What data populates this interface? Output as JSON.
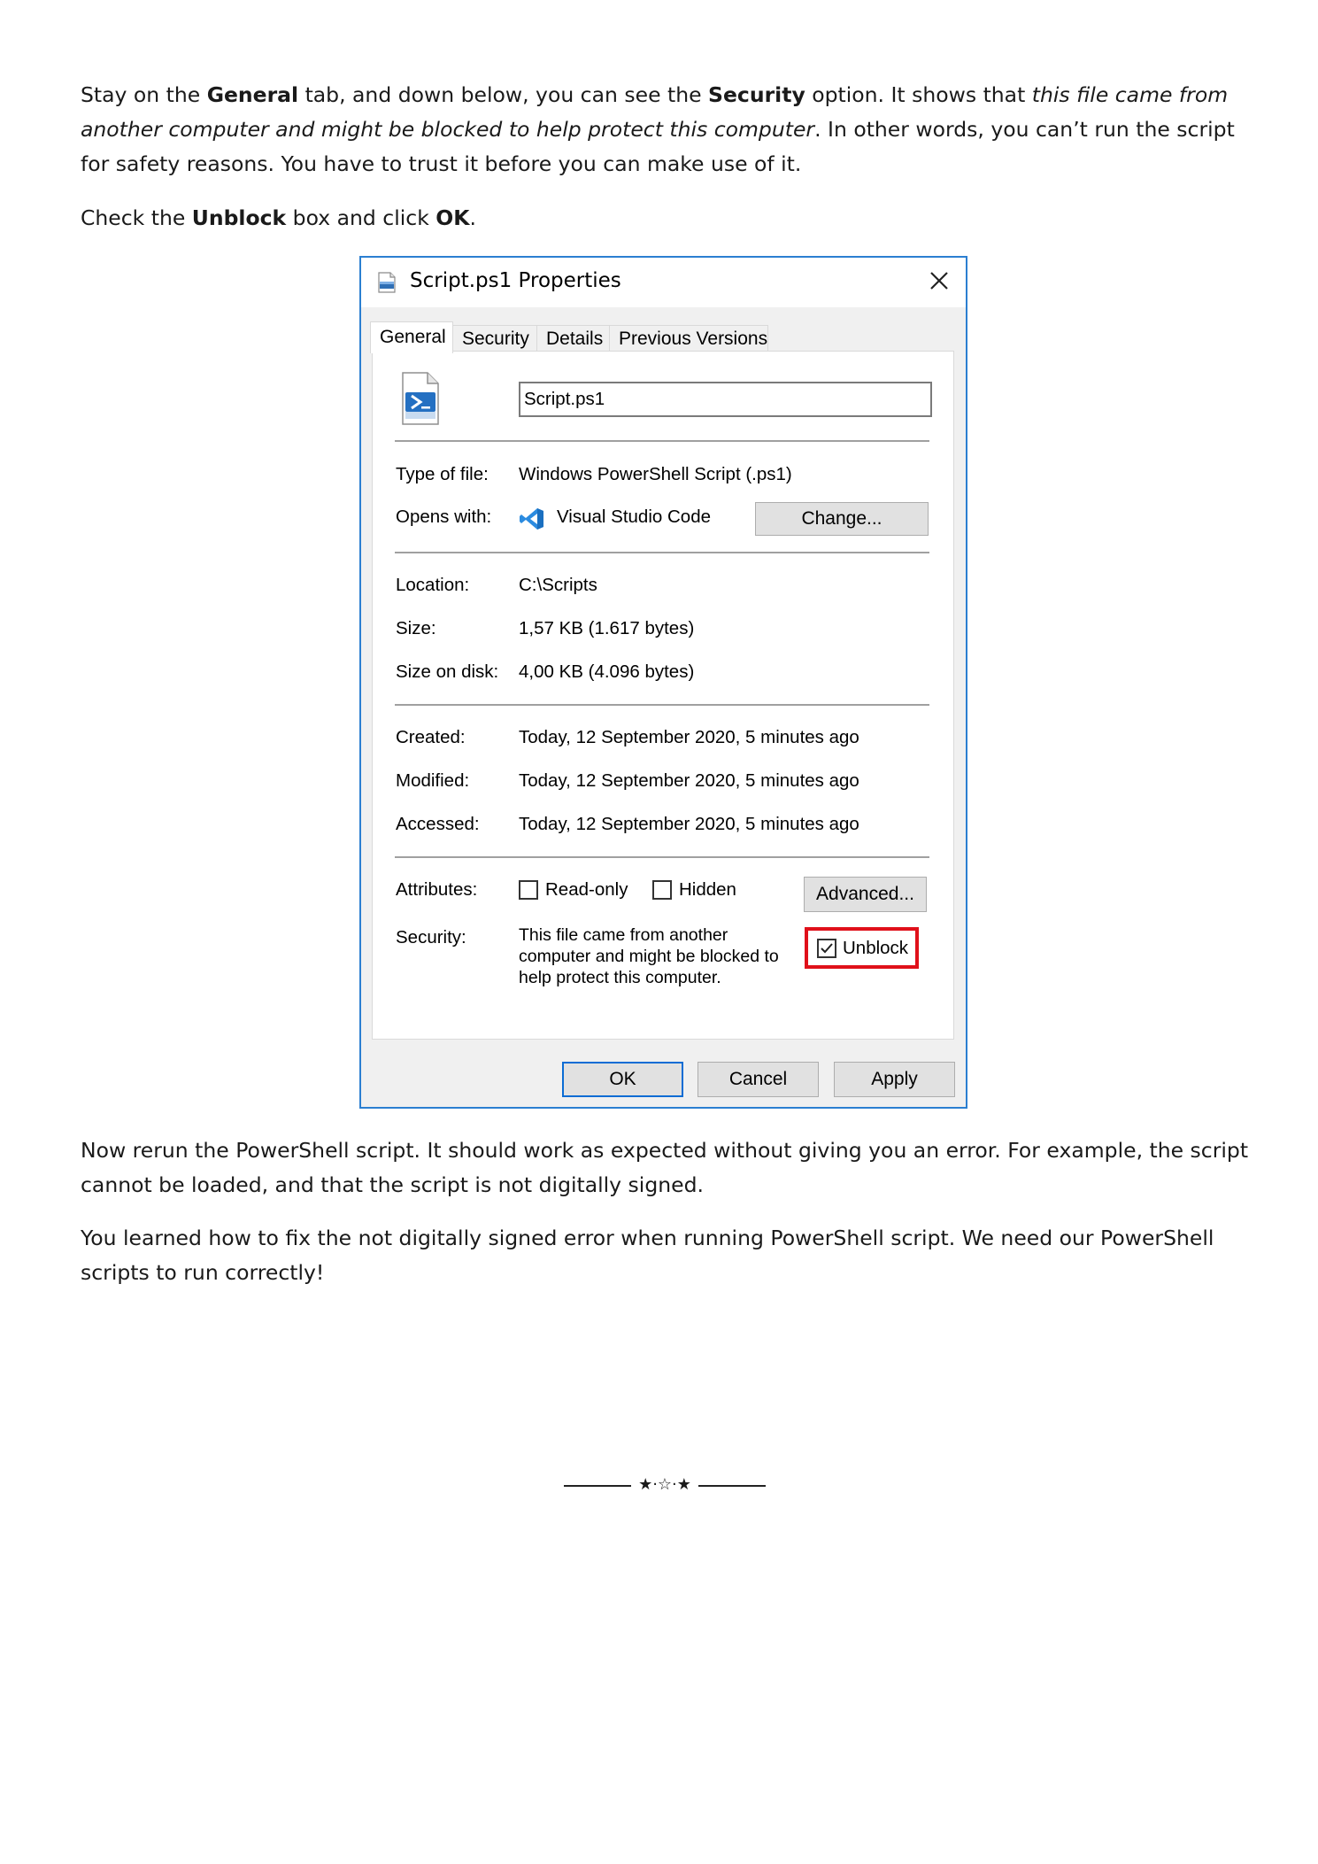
{
  "intro": {
    "s1": "Stay on the ",
    "b1": "General",
    "s2": " tab, and down below, you can see the ",
    "b2": "Security",
    "s3": " option. It shows that ",
    "i1": "this file came from another computer and might be blocked to help protect this computer",
    "s4": ". In other words, you can’t run the script for safety reasons. You have to trust it before you can make use of it."
  },
  "instruction": {
    "s1": "Check the ",
    "b1": "Unblock",
    "s2": " box and click ",
    "b2": "OK",
    "s3": "."
  },
  "dialog": {
    "title": "Script.ps1 Properties",
    "tabs": [
      "General",
      "Security",
      "Details",
      "Previous Versions"
    ],
    "active_tab": "General",
    "file_name": "Script.ps1",
    "type_label": "Type of file:",
    "type_value": "Windows PowerShell Script (.ps1)",
    "opens_label": "Opens with:",
    "opens_value": "Visual Studio Code",
    "change_button": "Change...",
    "location_label": "Location:",
    "location_value": "C:\\Scripts",
    "size_label": "Size:",
    "size_value": "1,57 KB (1.617 bytes)",
    "size_disk_label": "Size on disk:",
    "size_disk_value": "4,00 KB (4.096 bytes)",
    "created_label": "Created:",
    "created_value": "Today, 12 September 2020, 5 minutes ago",
    "modified_label": "Modified:",
    "modified_value": "Today, 12 September 2020, 5 minutes ago",
    "accessed_label": "Accessed:",
    "accessed_value": "Today, 12 September 2020, 5 minutes ago",
    "attributes_label": "Attributes:",
    "readonly_label": "Read-only",
    "readonly_checked": false,
    "hidden_label": "Hidden",
    "hidden_checked": false,
    "advanced_button": "Advanced...",
    "security_label": "Security:",
    "security_text": "This file came from another computer and might be blocked to help protect this computer.",
    "unblock_label": "Unblock",
    "unblock_checked": true,
    "ok_button": "OK",
    "cancel_button": "Cancel",
    "apply_button": "Apply",
    "highlight_color": "#e0101a",
    "accent_color": "#2b7fd1"
  },
  "rerun": "Now rerun the PowerShell script. It should work as expected without giving you an error. For example, the script cannot be loaded, and that the script is not digitally signed.",
  "conclusion": "You learned how to fix the not digitally signed error when running PowerShell script. We need our PowerShell scripts to run correctly!",
  "ornament": "★·☆·★",
  "icons": [
    "file-icon",
    "close-icon",
    "powershell-file-icon",
    "vscode-icon",
    "checkmark-icon"
  ]
}
